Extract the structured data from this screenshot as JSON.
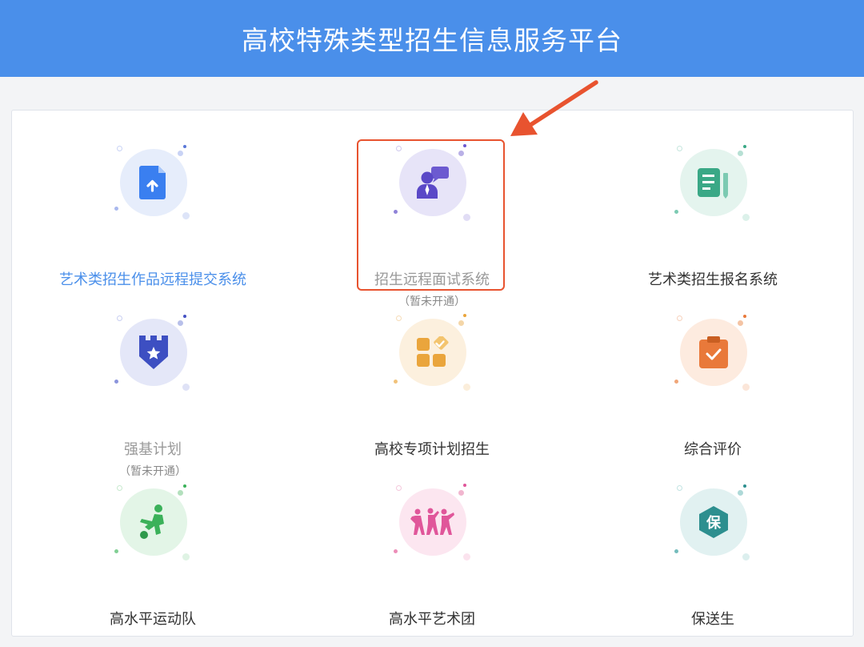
{
  "header": {
    "title": "高校特殊类型招生信息服务平台"
  },
  "colors": {
    "header_bg": "#4a8fea",
    "highlight": "#e8532f"
  },
  "tiles": [
    {
      "label": "艺术类招生作品远程提交系统",
      "sub": "",
      "icon": "upload-file-icon",
      "style": "blue"
    },
    {
      "label": "招生远程面试系统",
      "sub": "（暂未开通）",
      "icon": "interview-person-icon",
      "style": "gray"
    },
    {
      "label": "艺术类招生报名系统",
      "sub": "",
      "icon": "document-edit-icon",
      "style": "normal"
    },
    {
      "label": "强基计划",
      "sub": "（暂未开通）",
      "icon": "shield-star-icon",
      "style": "gray"
    },
    {
      "label": "高校专项计划招生",
      "sub": "",
      "icon": "apps-grid-icon",
      "style": "normal"
    },
    {
      "label": "综合评价",
      "sub": "",
      "icon": "clipboard-check-icon",
      "style": "normal"
    },
    {
      "label": "高水平运动队",
      "sub": "",
      "icon": "soccer-player-icon",
      "style": "normal"
    },
    {
      "label": "高水平艺术团",
      "sub": "",
      "icon": "dancers-icon",
      "style": "normal"
    },
    {
      "label": "保送生",
      "sub": "",
      "icon": "hexagon-bao-icon",
      "style": "normal"
    }
  ],
  "icon_text": {
    "bao": "保"
  }
}
